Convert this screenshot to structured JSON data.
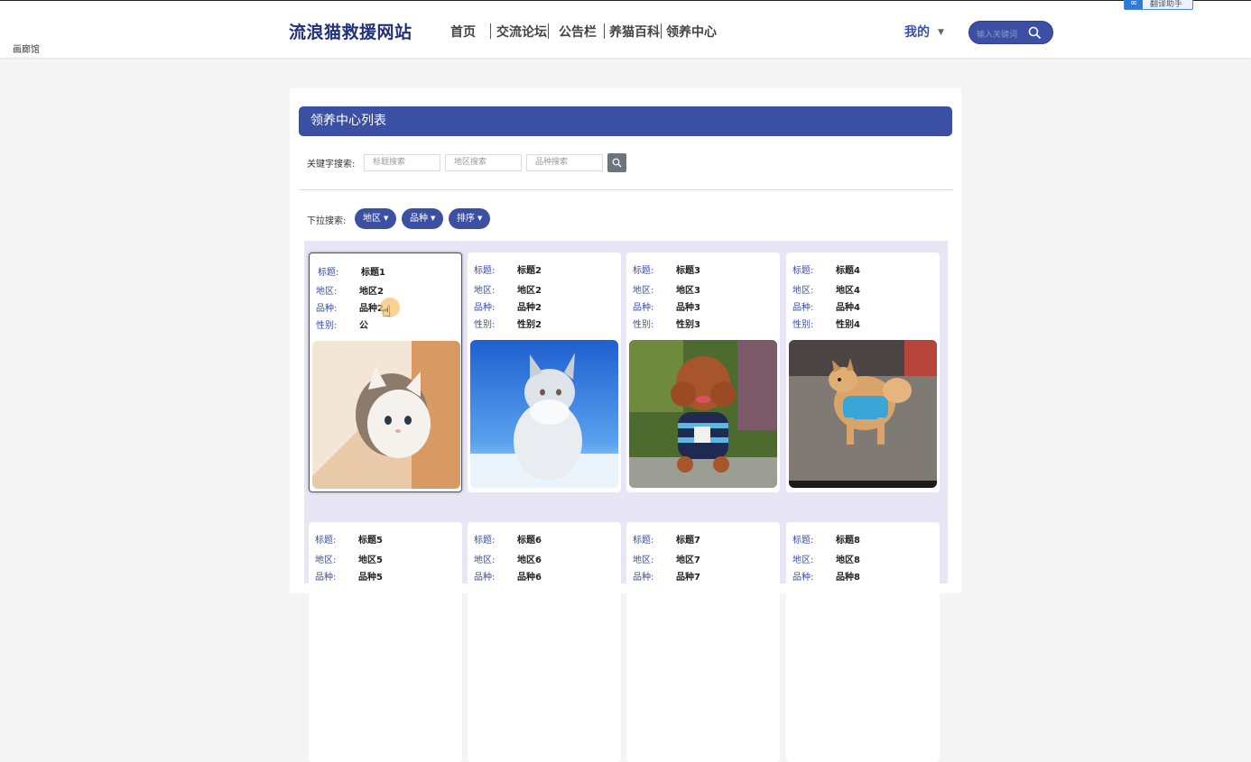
{
  "header": {
    "tiny_left": "画廊馆",
    "brand": "流浪猫救援网站",
    "nav": [
      {
        "label": "首页"
      },
      {
        "label": "交流论坛"
      },
      {
        "label": "公告栏"
      },
      {
        "label": "养猫百科"
      },
      {
        "label": "领养中心"
      }
    ],
    "user_menu": "我的",
    "search_placeholder": "输入关键词",
    "corner_badge_text": "翻译助手"
  },
  "main": {
    "title": "领养中心列表",
    "keyword_label": "关键字搜索:",
    "inputs": [
      {
        "placeholder": "标题搜索"
      },
      {
        "placeholder": "地区搜索"
      },
      {
        "placeholder": "品种搜索"
      }
    ],
    "dropdown_label": "下拉搜索:",
    "dropdowns": [
      {
        "label": "地区"
      },
      {
        "label": "品种"
      },
      {
        "label": "排序"
      }
    ],
    "field_labels": {
      "title": "标题:",
      "region": "地区:",
      "breed": "品种:",
      "gender": "性别:"
    },
    "cards": [
      {
        "title": "标题1",
        "region": "地区2",
        "breed": "品种2",
        "gender": "公",
        "photo": "white-kitten-photo"
      },
      {
        "title": "标题2",
        "region": "地区2",
        "breed": "品种2",
        "gender": "性别2",
        "photo": "fluffy-cat-photo"
      },
      {
        "title": "标题3",
        "region": "地区3",
        "breed": "品种3",
        "gender": "性别3",
        "photo": "poodle-photo"
      },
      {
        "title": "标题4",
        "region": "地区4",
        "breed": "品种4",
        "gender": "性别4",
        "photo": "pomeranian-photo"
      },
      {
        "title": "标题5",
        "region": "地区5",
        "breed": "品种5"
      },
      {
        "title": "标题6",
        "region": "地区6",
        "breed": "品种6"
      },
      {
        "title": "标题7",
        "region": "地区7",
        "breed": "品种7"
      },
      {
        "title": "标题8",
        "region": "地区8",
        "breed": "品种8"
      }
    ]
  },
  "colors": {
    "primary": "#3b4fa3",
    "brand": "#23307a",
    "grid_bg": "#e8e6f6",
    "page_bg": "#f4f4f5"
  }
}
